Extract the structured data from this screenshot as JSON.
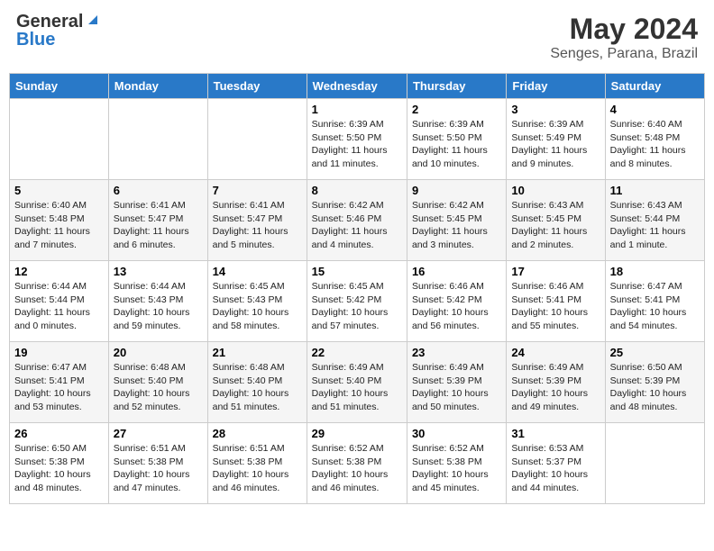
{
  "logo": {
    "general": "General",
    "blue": "Blue"
  },
  "title": {
    "month_year": "May 2024",
    "location": "Senges, Parana, Brazil"
  },
  "headers": [
    "Sunday",
    "Monday",
    "Tuesday",
    "Wednesday",
    "Thursday",
    "Friday",
    "Saturday"
  ],
  "weeks": [
    [
      {
        "day": "",
        "info": ""
      },
      {
        "day": "",
        "info": ""
      },
      {
        "day": "",
        "info": ""
      },
      {
        "day": "1",
        "info": "Sunrise: 6:39 AM\nSunset: 5:50 PM\nDaylight: 11 hours and 11 minutes."
      },
      {
        "day": "2",
        "info": "Sunrise: 6:39 AM\nSunset: 5:50 PM\nDaylight: 11 hours and 10 minutes."
      },
      {
        "day": "3",
        "info": "Sunrise: 6:39 AM\nSunset: 5:49 PM\nDaylight: 11 hours and 9 minutes."
      },
      {
        "day": "4",
        "info": "Sunrise: 6:40 AM\nSunset: 5:48 PM\nDaylight: 11 hours and 8 minutes."
      }
    ],
    [
      {
        "day": "5",
        "info": "Sunrise: 6:40 AM\nSunset: 5:48 PM\nDaylight: 11 hours and 7 minutes."
      },
      {
        "day": "6",
        "info": "Sunrise: 6:41 AM\nSunset: 5:47 PM\nDaylight: 11 hours and 6 minutes."
      },
      {
        "day": "7",
        "info": "Sunrise: 6:41 AM\nSunset: 5:47 PM\nDaylight: 11 hours and 5 minutes."
      },
      {
        "day": "8",
        "info": "Sunrise: 6:42 AM\nSunset: 5:46 PM\nDaylight: 11 hours and 4 minutes."
      },
      {
        "day": "9",
        "info": "Sunrise: 6:42 AM\nSunset: 5:45 PM\nDaylight: 11 hours and 3 minutes."
      },
      {
        "day": "10",
        "info": "Sunrise: 6:43 AM\nSunset: 5:45 PM\nDaylight: 11 hours and 2 minutes."
      },
      {
        "day": "11",
        "info": "Sunrise: 6:43 AM\nSunset: 5:44 PM\nDaylight: 11 hours and 1 minute."
      }
    ],
    [
      {
        "day": "12",
        "info": "Sunrise: 6:44 AM\nSunset: 5:44 PM\nDaylight: 11 hours and 0 minutes."
      },
      {
        "day": "13",
        "info": "Sunrise: 6:44 AM\nSunset: 5:43 PM\nDaylight: 10 hours and 59 minutes."
      },
      {
        "day": "14",
        "info": "Sunrise: 6:45 AM\nSunset: 5:43 PM\nDaylight: 10 hours and 58 minutes."
      },
      {
        "day": "15",
        "info": "Sunrise: 6:45 AM\nSunset: 5:42 PM\nDaylight: 10 hours and 57 minutes."
      },
      {
        "day": "16",
        "info": "Sunrise: 6:46 AM\nSunset: 5:42 PM\nDaylight: 10 hours and 56 minutes."
      },
      {
        "day": "17",
        "info": "Sunrise: 6:46 AM\nSunset: 5:41 PM\nDaylight: 10 hours and 55 minutes."
      },
      {
        "day": "18",
        "info": "Sunrise: 6:47 AM\nSunset: 5:41 PM\nDaylight: 10 hours and 54 minutes."
      }
    ],
    [
      {
        "day": "19",
        "info": "Sunrise: 6:47 AM\nSunset: 5:41 PM\nDaylight: 10 hours and 53 minutes."
      },
      {
        "day": "20",
        "info": "Sunrise: 6:48 AM\nSunset: 5:40 PM\nDaylight: 10 hours and 52 minutes."
      },
      {
        "day": "21",
        "info": "Sunrise: 6:48 AM\nSunset: 5:40 PM\nDaylight: 10 hours and 51 minutes."
      },
      {
        "day": "22",
        "info": "Sunrise: 6:49 AM\nSunset: 5:40 PM\nDaylight: 10 hours and 51 minutes."
      },
      {
        "day": "23",
        "info": "Sunrise: 6:49 AM\nSunset: 5:39 PM\nDaylight: 10 hours and 50 minutes."
      },
      {
        "day": "24",
        "info": "Sunrise: 6:49 AM\nSunset: 5:39 PM\nDaylight: 10 hours and 49 minutes."
      },
      {
        "day": "25",
        "info": "Sunrise: 6:50 AM\nSunset: 5:39 PM\nDaylight: 10 hours and 48 minutes."
      }
    ],
    [
      {
        "day": "26",
        "info": "Sunrise: 6:50 AM\nSunset: 5:38 PM\nDaylight: 10 hours and 48 minutes."
      },
      {
        "day": "27",
        "info": "Sunrise: 6:51 AM\nSunset: 5:38 PM\nDaylight: 10 hours and 47 minutes."
      },
      {
        "day": "28",
        "info": "Sunrise: 6:51 AM\nSunset: 5:38 PM\nDaylight: 10 hours and 46 minutes."
      },
      {
        "day": "29",
        "info": "Sunrise: 6:52 AM\nSunset: 5:38 PM\nDaylight: 10 hours and 46 minutes."
      },
      {
        "day": "30",
        "info": "Sunrise: 6:52 AM\nSunset: 5:38 PM\nDaylight: 10 hours and 45 minutes."
      },
      {
        "day": "31",
        "info": "Sunrise: 6:53 AM\nSunset: 5:37 PM\nDaylight: 10 hours and 44 minutes."
      },
      {
        "day": "",
        "info": ""
      }
    ]
  ]
}
